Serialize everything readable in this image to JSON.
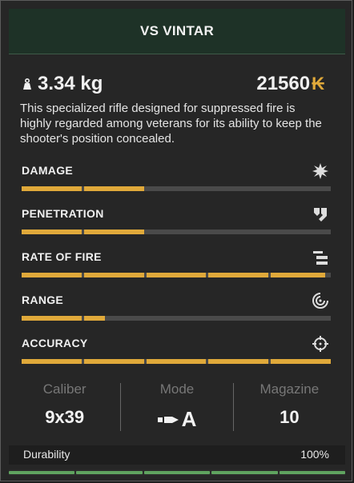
{
  "header": {
    "title": "VS VINTAR"
  },
  "summary": {
    "weight": "3.34 kg",
    "price": "21560",
    "currency_symbol": "₭",
    "description": "This specialized rifle designed for suppressed fire is highly regarded among veterans for its ability to keep the shooter's position concealed."
  },
  "stats": [
    {
      "label": "DAMAGE",
      "icon": "explosion-icon",
      "value": 0.4
    },
    {
      "label": "PENETRATION",
      "icon": "armor-piercing-icon",
      "value": 0.4
    },
    {
      "label": "RATE OF FIRE",
      "icon": "rate-of-fire-icon",
      "value": 0.98
    },
    {
      "label": "RANGE",
      "icon": "range-icon",
      "value": 0.27
    },
    {
      "label": "ACCURACY",
      "icon": "crosshair-icon",
      "value": 1.0
    }
  ],
  "info": {
    "caliber_label": "Caliber",
    "caliber_value": "9x39",
    "mode_label": "Mode",
    "mode_value": "A",
    "magazine_label": "Magazine",
    "magazine_value": "10"
  },
  "durability": {
    "label": "Durability",
    "value": "100%",
    "level": 1.0
  },
  "colors": {
    "accent": "#e0a93a",
    "header_bg": "#1e3227",
    "durability": "#5fa35f"
  }
}
